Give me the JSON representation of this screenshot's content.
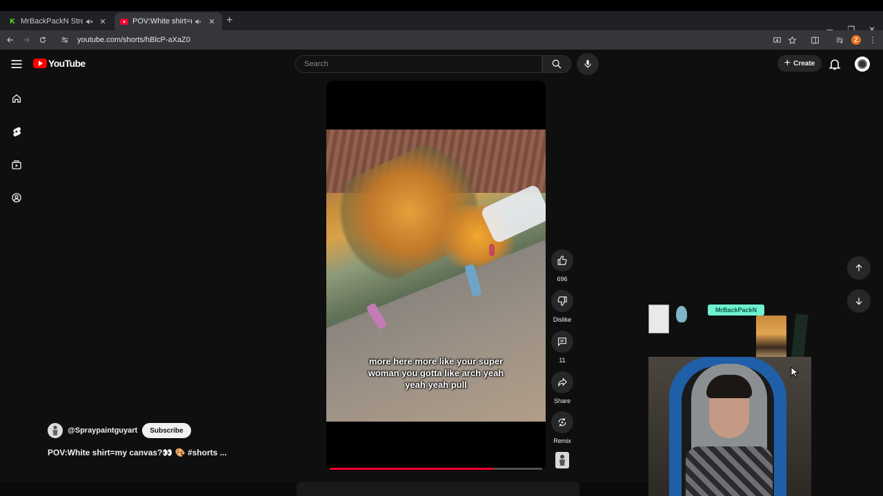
{
  "browser": {
    "tabs": [
      {
        "title": "MrBackPackN Stream - Wa",
        "favicon_letter": "K",
        "favicon_color": "#53fc18"
      },
      {
        "title": "POV:White shirt=my canva",
        "favicon_color": "#ff0033"
      }
    ],
    "url": "youtube.com/shorts/hBlcP-aXaZ0",
    "profile_initial": "Z"
  },
  "youtube": {
    "logo_text": "YouTube",
    "search_placeholder": "Search",
    "create_label": "Create",
    "guide": [
      "home-icon",
      "shorts-icon",
      "subscriptions-icon",
      "you-icon"
    ]
  },
  "short": {
    "captions": "more here more like your super woman you gotta like arch yeah yeah yeah pull",
    "progress": 0.77,
    "actions": {
      "likes": "696",
      "dislike_label": "Dislike",
      "comments": "11",
      "share_label": "Share",
      "remix_label": "Remix"
    },
    "channel": "@Spraypaintguyart",
    "subscribe_label": "Subscribe",
    "title": "POV:White shirt=my canvas?👀 🎨 #shorts ..."
  },
  "overlay": {
    "banner_text": "MrBackPackN"
  },
  "colors": {
    "brand_red": "#ff0000",
    "background": "#0f0f0f",
    "progress": "#ff0033"
  }
}
